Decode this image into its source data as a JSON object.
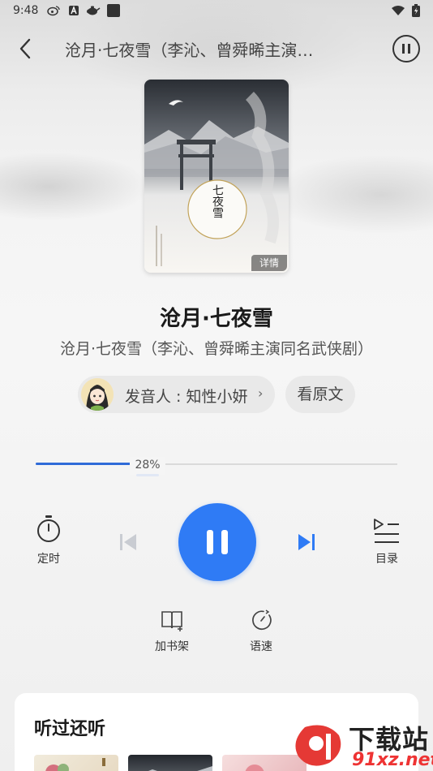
{
  "status_bar": {
    "time": "9:48"
  },
  "header": {
    "title": "沧月·七夜雪（李沁、曾舜晞主演…"
  },
  "book": {
    "cover_title": "七夜雪",
    "detail_badge": "详情",
    "title": "沧月·七夜雪",
    "subtitle": "沧月·七夜雪（李沁、曾舜晞主演同名武侠剧）"
  },
  "narrator": {
    "label": "发音人 : 知性小妍",
    "chevron": "›"
  },
  "original_button": "看原文",
  "progress": {
    "percent": 28,
    "label": "28%"
  },
  "controls": {
    "timer_label": "定时",
    "toc_label": "目录",
    "shelf_label": "加书架",
    "speed_label": "语速"
  },
  "recommendations": {
    "title": "听过还听"
  },
  "watermark": {
    "text": "下载站",
    "url": "91xz.net"
  },
  "colors": {
    "accent": "#2f7bf5",
    "progress": "#2f6bd8",
    "watermark_red": "#e33333"
  }
}
